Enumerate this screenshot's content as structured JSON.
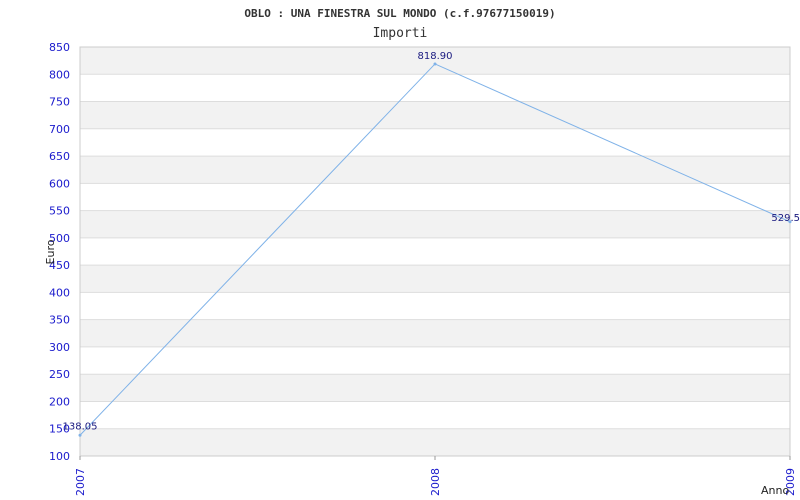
{
  "chart_data": {
    "type": "line",
    "title": "OBLO : UNA FINESTRA SUL MONDO (c.f.97677150019)",
    "subtitle": "Importi",
    "xlabel": "Anno",
    "ylabel": "Euro",
    "x": [
      "2007",
      "2008",
      "2009"
    ],
    "series": [
      {
        "values": [
          138.05,
          818.9,
          529.5
        ]
      }
    ],
    "data_labels": [
      "138.05",
      "818.90",
      "529.5"
    ],
    "ylim": [
      100,
      850
    ],
    "yticks": [
      100,
      150,
      200,
      250,
      300,
      350,
      400,
      450,
      500,
      550,
      600,
      650,
      700,
      750,
      800,
      850
    ],
    "grid": true,
    "colors": {
      "line": "#7fb2e8",
      "band": "#f2f2f2",
      "grid": "#dddddd",
      "tick": "#1a1acc"
    }
  }
}
